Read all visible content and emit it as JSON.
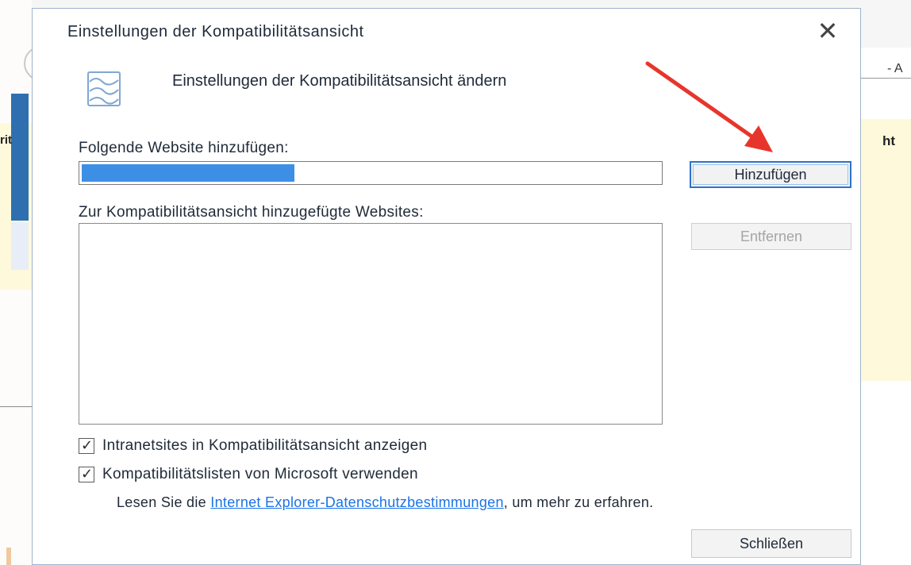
{
  "background": {
    "left_fragment_text": "rit",
    "right_fragment_top_text": "- A",
    "right_fragment_mid_text": "ht"
  },
  "dialog": {
    "title": "Einstellungen der Kompatibilitätsansicht",
    "close_glyph": "✕",
    "header_text": "Einstellungen der Kompatibilitätsansicht ändern",
    "add_site_label": "Folgende Website hinzufügen:",
    "url_value": "",
    "add_button": "Hinzufügen",
    "list_label": "Zur Kompatibilitätsansicht hinzugefügte Websites:",
    "list_items": [],
    "remove_button": "Entfernen",
    "checkbox_intranet": {
      "label": "Intranetsites in Kompatibilitätsansicht anzeigen",
      "checked": true
    },
    "checkbox_microsoft": {
      "label": "Kompatibilitätslisten von Microsoft verwenden",
      "checked": true
    },
    "privacy_prefix": "Lesen Sie die ",
    "privacy_link": "Internet Explorer-Datenschutzbestimmungen",
    "privacy_suffix": ", um mehr zu erfahren.",
    "close_button": "Schließen"
  },
  "annotation": {
    "arrow_color": "#e8352b"
  },
  "colors": {
    "accent": "#2e73c9",
    "link": "#1a73e8",
    "selection": "#3d8fe6"
  }
}
